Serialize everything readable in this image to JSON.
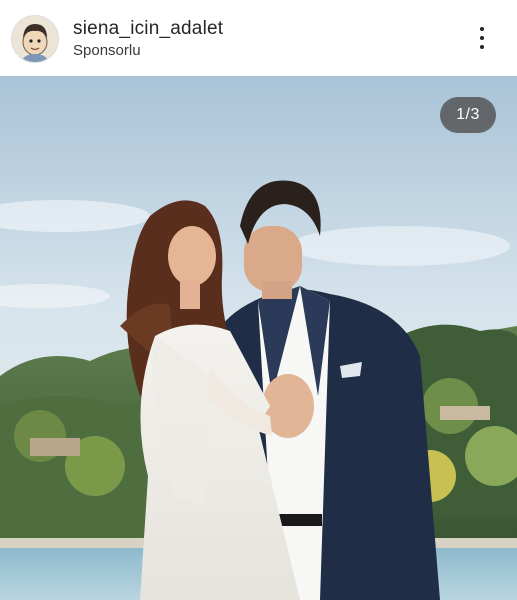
{
  "post": {
    "username": "siena_icin_adalet",
    "sponsored_label": "Sponsorlu",
    "avatar_icon": "cartoon-boy-avatar",
    "more_icon": "vertical-ellipsis-icon"
  },
  "carousel": {
    "current": 1,
    "total": 3,
    "counter_text": "1/3"
  },
  "colors": {
    "header_bg": "#ffffff",
    "text": "#262626",
    "counter_bg": "#505050"
  }
}
